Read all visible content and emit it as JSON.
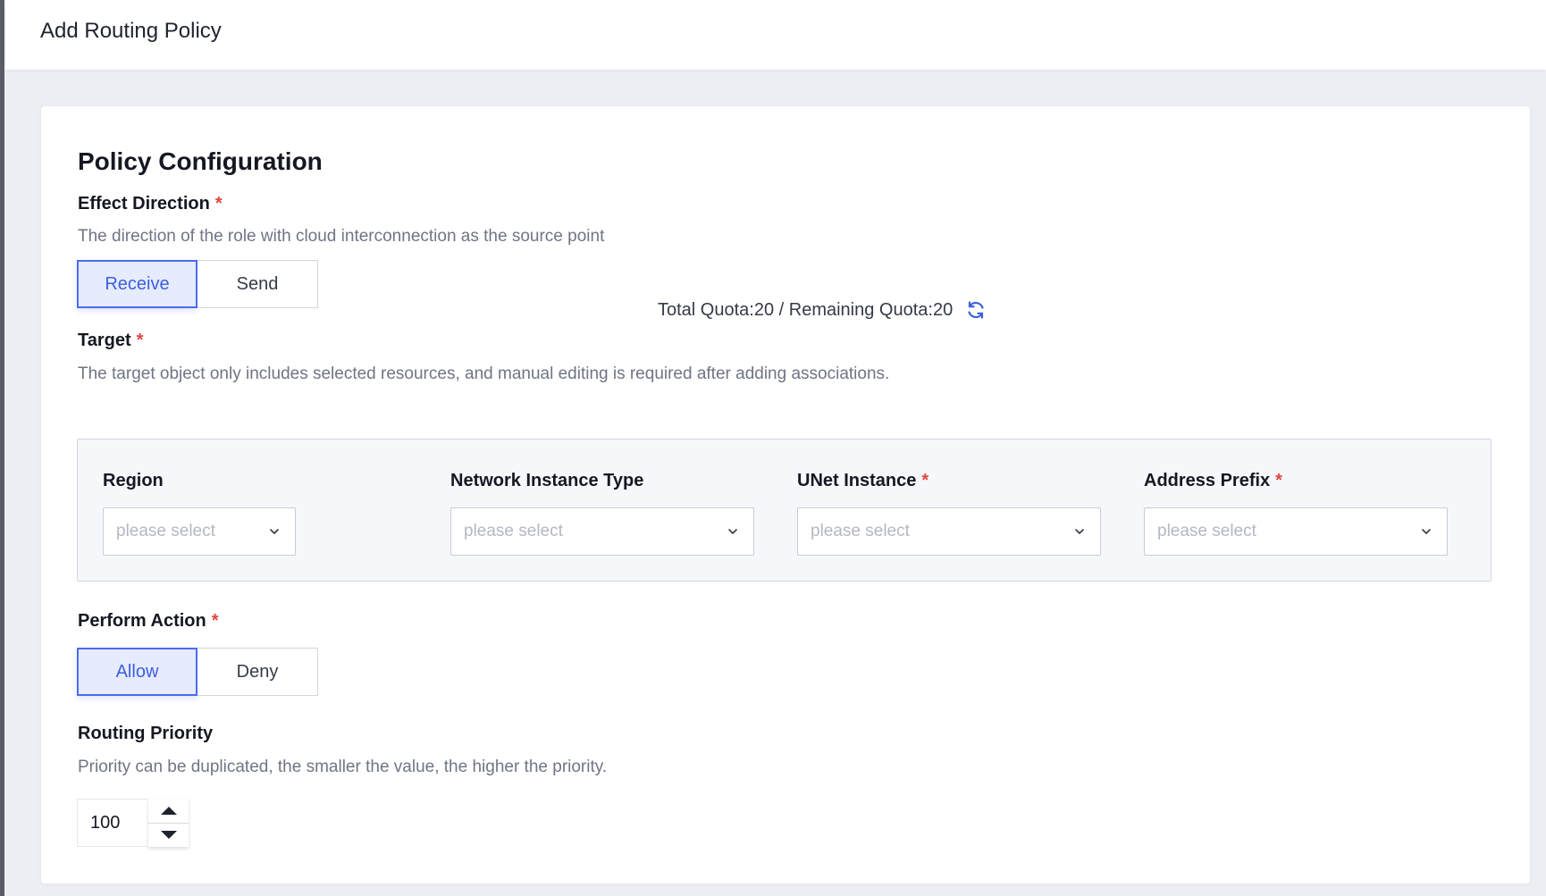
{
  "header": {
    "title": "Add Routing Policy"
  },
  "section": {
    "title": "Policy Configuration"
  },
  "effect_direction": {
    "label": "Effect Direction",
    "required_mark": "*",
    "help": "The direction of the role with cloud interconnection as the source point",
    "options": [
      "Receive",
      "Send"
    ],
    "selected": "Receive"
  },
  "quota": {
    "text": "Total Quota:20 / Remaining Quota:20"
  },
  "target": {
    "label": "Target",
    "required_mark": "*",
    "help": "The target object only includes selected resources, and manual editing is required after adding associations.",
    "fields": [
      {
        "label": "Region",
        "required": "",
        "placeholder": "please select"
      },
      {
        "label": "Network Instance Type",
        "required": "",
        "placeholder": "please select"
      },
      {
        "label": "UNet Instance",
        "required": "*",
        "placeholder": "please select"
      },
      {
        "label": "Address Prefix",
        "required": "*",
        "placeholder": "please select"
      }
    ]
  },
  "perform_action": {
    "label": "Perform Action",
    "required_mark": "*",
    "options": [
      "Allow",
      "Deny"
    ],
    "selected": "Allow"
  },
  "routing_priority": {
    "label": "Routing Priority",
    "help": "Priority can be duplicated, the smaller the value, the higher the priority.",
    "value": "100"
  },
  "colors": {
    "accent": "#4a6cf0",
    "required": "#e0463f",
    "active_bg": "#e6ebfd"
  },
  "icons": [
    "refresh-icon",
    "chevron-down-icon",
    "caret-up-icon",
    "caret-down-icon"
  ]
}
